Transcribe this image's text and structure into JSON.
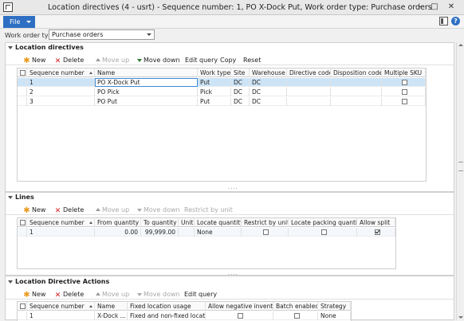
{
  "window": {
    "title": "Location directives (4 - usrt) - Sequence number: 1, PO X-Dock Put, Work order type: Purchase orders",
    "icon": "app-icon"
  },
  "menu": {
    "file_label": "File",
    "layout_icon": "layout-icon",
    "help_icon": "help-icon"
  },
  "filter": {
    "label": "Work order type:",
    "value": "Purchase orders"
  },
  "location_directives": {
    "header": "Location directives",
    "toolbar": {
      "new": "New",
      "delete": "Delete",
      "move_up": "Move up",
      "move_down": "Move down",
      "edit_query": "Edit query",
      "copy": "Copy",
      "reset": "Reset"
    },
    "columns": [
      "Sequence number",
      "Name",
      "Work type",
      "Site",
      "Warehouse",
      "Directive code",
      "Disposition code",
      "Multiple SKU"
    ],
    "rows": [
      {
        "seq": "1",
        "name": "PO X-Dock Put",
        "work_type": "Put",
        "site": "DC",
        "warehouse": "DC",
        "directive_code": "",
        "disposition_code": "",
        "multiple_sku": false
      },
      {
        "seq": "2",
        "name": "PO Pick",
        "work_type": "Pick",
        "site": "DC",
        "warehouse": "DC",
        "directive_code": "",
        "disposition_code": "",
        "multiple_sku": false
      },
      {
        "seq": "3",
        "name": "PO Put",
        "work_type": "Put",
        "site": "DC",
        "warehouse": "DC",
        "directive_code": "",
        "disposition_code": "",
        "multiple_sku": false
      }
    ]
  },
  "lines": {
    "header": "Lines",
    "toolbar": {
      "new": "New",
      "delete": "Delete",
      "move_up": "Move up",
      "move_down": "Move down",
      "restrict_by_unit": "Restrict by unit"
    },
    "columns": [
      "Sequence number",
      "From quantity",
      "To quantity",
      "Unit",
      "Locate quantity",
      "Restrict by unit",
      "Locate packing quantity",
      "Allow split"
    ],
    "rows": [
      {
        "seq": "1",
        "from_qty": "0.00",
        "to_qty": "99,999.00",
        "unit": "",
        "locate_qty": "None",
        "restrict_by_unit": false,
        "locate_packing_qty": false,
        "allow_split": true
      }
    ]
  },
  "actions": {
    "header": "Location Directive Actions",
    "toolbar": {
      "new": "New",
      "delete": "Delete",
      "move_up": "Move up",
      "move_down": "Move down",
      "edit_query": "Edit query"
    },
    "columns": [
      "Sequence number",
      "Name",
      "Fixed location usage",
      "Allow negative inventory",
      "Batch enabled",
      "Strategy"
    ],
    "rows": [
      {
        "seq": "1",
        "name": "X-Dock ...",
        "fixed_location_usage": "Fixed and non-fixed locations",
        "allow_negative": false,
        "batch_enabled": false,
        "strategy": "None"
      }
    ]
  }
}
